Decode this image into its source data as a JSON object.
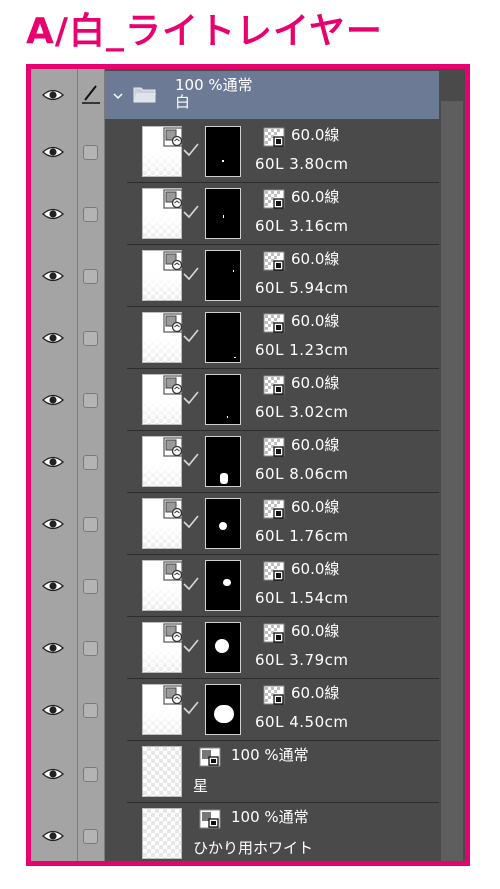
{
  "page_title": "A/白_ライトレイヤー",
  "colors": {
    "accent": "#e8006f",
    "panel_bg": "#4a4a4a",
    "folder_highlight": "#6c7a95",
    "side_strip": "#a4a4a4"
  },
  "header": {
    "pen_icon": "pen-icon"
  },
  "folder": {
    "opacity_blend": "100 %通常",
    "name": "白"
  },
  "layers": [
    {
      "opacity_blend": "60.0線",
      "meta": "60L 3.80cm"
    },
    {
      "opacity_blend": "60.0線",
      "meta": "60L 3.16cm"
    },
    {
      "opacity_blend": "60.0線",
      "meta": "60L 5.94cm"
    },
    {
      "opacity_blend": "60.0線",
      "meta": "60L 1.23cm"
    },
    {
      "opacity_blend": "60.0線",
      "meta": "60L 3.02cm"
    },
    {
      "opacity_blend": "60.0線",
      "meta": "60L 8.06cm"
    },
    {
      "opacity_blend": "60.0線",
      "meta": "60L 1.76cm"
    },
    {
      "opacity_blend": "60.0線",
      "meta": "60L 1.54cm"
    },
    {
      "opacity_blend": "60.0線",
      "meta": "60L 3.79cm"
    },
    {
      "opacity_blend": "60.0線",
      "meta": "60L 4.50cm"
    }
  ],
  "raster_layers": [
    {
      "opacity_blend": "100 %通常",
      "name": "星"
    },
    {
      "opacity_blend": "100 %通常",
      "name": "ひかり用ホワイト"
    }
  ]
}
